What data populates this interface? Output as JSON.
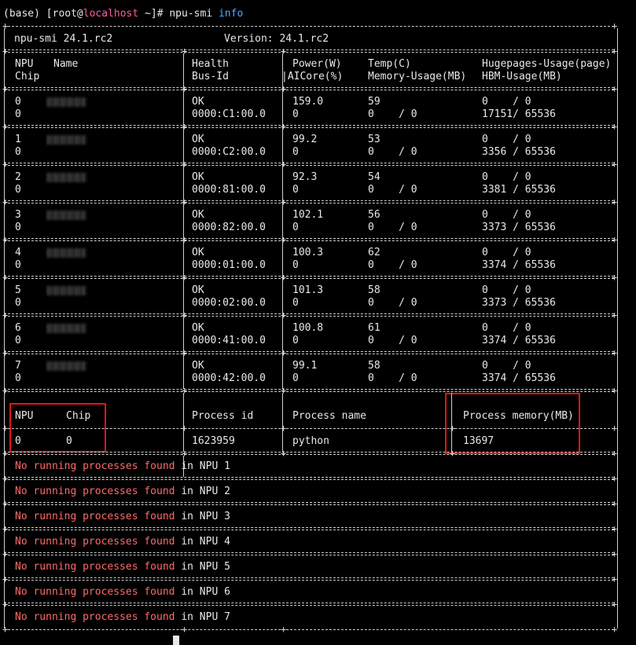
{
  "prompt": {
    "env": "(base)",
    "user_open": "[root@",
    "host": "localhost",
    "path": " ~]# ",
    "cmd": "npu-smi ",
    "arg": "info"
  },
  "header": {
    "tool": "npu-smi 24.1.rc2",
    "version": "Version: 24.1.rc2"
  },
  "columns": {
    "npu": "NPU",
    "name": "Name",
    "chip": "Chip",
    "health": "Health",
    "bus_id": "Bus-Id",
    "power": "Power(W)",
    "aicore": "AICore(%)",
    "temp": "Temp(C)",
    "memory_usage": "Memory-Usage(MB)",
    "hugepages": "Hugepages-Usage(page)",
    "hbm": "HBM-Usage(MB)"
  },
  "npus": [
    {
      "npu": "0",
      "chip": "0",
      "health": "OK",
      "bus_id": "0000:C1:00.0",
      "power": "159.0",
      "aicore": "0",
      "temp": "59",
      "mem": "0    / 0",
      "huge": "0    / 0",
      "hbm": "17151/ 65536"
    },
    {
      "npu": "1",
      "chip": "0",
      "health": "OK",
      "bus_id": "0000:C2:00.0",
      "power": "99.2",
      "aicore": "0",
      "temp": "53",
      "mem": "0    / 0",
      "huge": "0    / 0",
      "hbm": "3356 / 65536"
    },
    {
      "npu": "2",
      "chip": "0",
      "health": "OK",
      "bus_id": "0000:81:00.0",
      "power": "92.3",
      "aicore": "0",
      "temp": "54",
      "mem": "0    / 0",
      "huge": "0    / 0",
      "hbm": "3381 / 65536"
    },
    {
      "npu": "3",
      "chip": "0",
      "health": "OK",
      "bus_id": "0000:82:00.0",
      "power": "102.1",
      "aicore": "0",
      "temp": "56",
      "mem": "0    / 0",
      "huge": "0    / 0",
      "hbm": "3373 / 65536"
    },
    {
      "npu": "4",
      "chip": "0",
      "health": "OK",
      "bus_id": "0000:01:00.0",
      "power": "100.3",
      "aicore": "0",
      "temp": "62",
      "mem": "0    / 0",
      "huge": "0    / 0",
      "hbm": "3374 / 65536"
    },
    {
      "npu": "5",
      "chip": "0",
      "health": "OK",
      "bus_id": "0000:02:00.0",
      "power": "101.3",
      "aicore": "0",
      "temp": "58",
      "mem": "0    / 0",
      "huge": "0    / 0",
      "hbm": "3373 / 65536"
    },
    {
      "npu": "6",
      "chip": "0",
      "health": "OK",
      "bus_id": "0000:41:00.0",
      "power": "100.8",
      "aicore": "0",
      "temp": "61",
      "mem": "0    / 0",
      "huge": "0    / 0",
      "hbm": "3374 / 65536"
    },
    {
      "npu": "7",
      "chip": "0",
      "health": "OK",
      "bus_id": "0000:42:00.0",
      "power": "99.1",
      "aicore": "0",
      "temp": "58",
      "mem": "0    / 0",
      "huge": "0    / 0",
      "hbm": "3374 / 65536"
    }
  ],
  "process_columns": {
    "npu": "NPU",
    "chip": "Chip",
    "pid": "Process id",
    "name": "Process name",
    "memory": "Process memory(MB)"
  },
  "process": {
    "npu": "0",
    "chip": "0",
    "pid": "1623959",
    "name": "python",
    "memory": "13697"
  },
  "no_process": {
    "prefix": "No running processes found",
    "suffix": " in NPU ",
    "npus": [
      "1",
      "2",
      "3",
      "4",
      "5",
      "6",
      "7"
    ]
  },
  "colors": {
    "background": "#000000",
    "text": "#e8e8e8",
    "highlight_box": "#e0141a",
    "error_text": "#ff6a6a",
    "arg_text": "#4fa8ff",
    "host_text": "#ff5aa0"
  }
}
